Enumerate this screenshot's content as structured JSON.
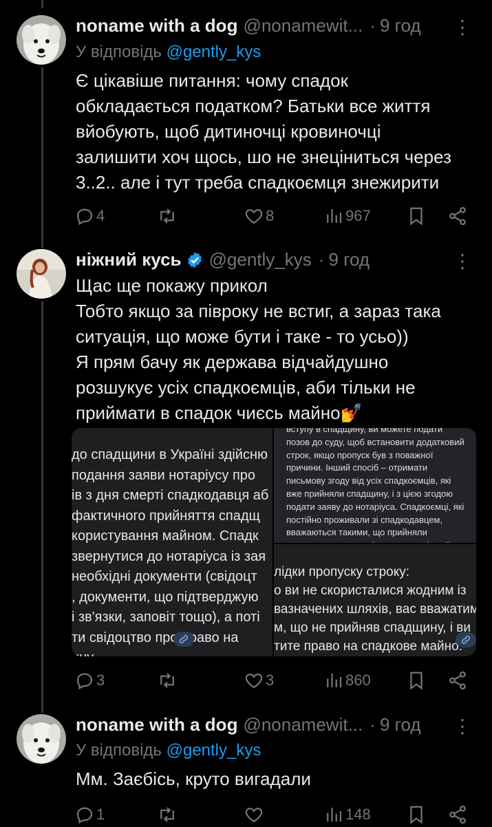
{
  "tweets": [
    {
      "author_name": "noname with a dog",
      "handle": "@nonamewit...",
      "dot": "·",
      "time": "9 год",
      "more": "⋮",
      "reply_prefix": "У відповідь",
      "reply_mention": "@gently_kys",
      "lines": [
        "Є цікавіше питання: чому спадок",
        "обкладається податком? Батьки все життя",
        "вйобують, щоб дитиночці кровиночці",
        "залишити хоч щось, шо не знеціниться через",
        "3..2.. але і тут треба спадкоємця знежирити"
      ],
      "replies": "4",
      "retweets": "",
      "likes": "8",
      "views": "967"
    },
    {
      "author_name": "ніжний кусь",
      "handle": "@gently_kys",
      "dot": "·",
      "time": "9 год",
      "more": "⋮",
      "verified_color": "#1d9bf0",
      "lines": [
        "Щас ще покажу прикол",
        "Тобто якщо за півроку не встиг, а зараз така",
        "ситуація, що може бути і таке - то усьо))",
        "Я прям бачу як держава відчайдушно",
        "розшукує усіх спадкоємців, аби тільки не",
        "приймати в спадок чиєсь майно💅"
      ],
      "replies": "3",
      "retweets": "",
      "likes": "3",
      "views": "860",
      "images": {
        "left_lines": [
          "до спадщини в Україні здійсню",
          "подання заяви нотаріусу про",
          "ів з дня смерті спадкодавця аб",
          "фактичного прийняття спадщ",
          "користування майном. Спадк",
          "звернутися до нотаріуса із зая",
          "необхідні документи (свідоцт",
          ", документи, що підтверджую",
          "і зв'язки, заповіт тощо), а поті",
          "ти свідоцтво про право на",
          "ину."
        ],
        "top_right_lines": [
          "вступу в спадщину, ви можете подати",
          "позов до суду, щоб встановити додатковий",
          "строк, якщо пропуск був з поважної",
          "причини. Інший спосіб – отримати",
          "письмову згоду від усіх спадкоємців, які",
          "вже прийняли спадщину, і з цією згодою",
          "подати заяву до нотаріуса. Спадкоємці, які",
          "постійно проживали зі спадкодавцем,",
          "вважаються такими, що прийняли",
          "спадщину, якщо не відмовилися від неї"
        ],
        "bottom_right_lines": [
          "лідки пропуску строку:",
          "о ви не скористалися жодним із",
          "вазначених шляхів, вас вважатиму",
          "м, що не прийняв спадщину, і ви",
          "тите право на спадкове майно."
        ]
      }
    },
    {
      "author_name": "noname with a dog",
      "handle": "@nonamewit...",
      "dot": "·",
      "time": "9 год",
      "more": "⋮",
      "reply_prefix": "У відповідь",
      "reply_mention": "@gently_kys",
      "lines": [
        "Мм. Заєбісь, круто вигадали"
      ],
      "replies": "1",
      "retweets": "",
      "likes": "",
      "views": "148"
    }
  ],
  "colors": {
    "background": "#000000",
    "text": "#e7e9ea",
    "secondary": "#71767b",
    "accent": "#1d9bf0",
    "divider": "#2f3336"
  },
  "icons": [
    "reply-icon",
    "retweet-icon",
    "like-icon",
    "views-icon",
    "bookmark-icon",
    "share-icon",
    "verified-icon",
    "more-icon",
    "link-icon"
  ]
}
